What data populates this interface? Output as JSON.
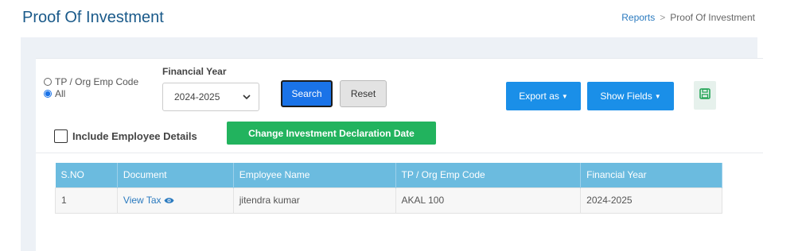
{
  "page": {
    "title": "Proof Of Investment"
  },
  "breadcrumb": {
    "parent": "Reports",
    "separator": ">",
    "current": "Proof Of Investment"
  },
  "filters": {
    "radio_code_label": "TP / Org Emp Code",
    "radio_all_label": "All",
    "selected_radio": "All",
    "financial_year_label": "Financial Year",
    "financial_year_value": "2024-2025",
    "include_employee_details_label": "Include Employee Details"
  },
  "buttons": {
    "search": "Search",
    "reset": "Reset",
    "export": "Export as",
    "show_fields": "Show Fields",
    "change_date": "Change Investment Declaration Date"
  },
  "icons": {
    "save": "save-icon",
    "view": "eye-icon",
    "dropdown": "chevron-down-icon"
  },
  "colors": {
    "primary": "#1a8fe8",
    "success": "#22b35e",
    "table_header": "#6bbbdf",
    "title": "#1a5a8a"
  },
  "table": {
    "headers": [
      "S.NO",
      "Document",
      "Employee Name",
      "TP / Org Emp Code",
      "Financial Year"
    ],
    "rows": [
      {
        "sno": "1",
        "document": "View Tax",
        "employee_name": "jitendra kumar",
        "emp_code": "AKAL 100",
        "financial_year": "2024-2025"
      }
    ]
  }
}
